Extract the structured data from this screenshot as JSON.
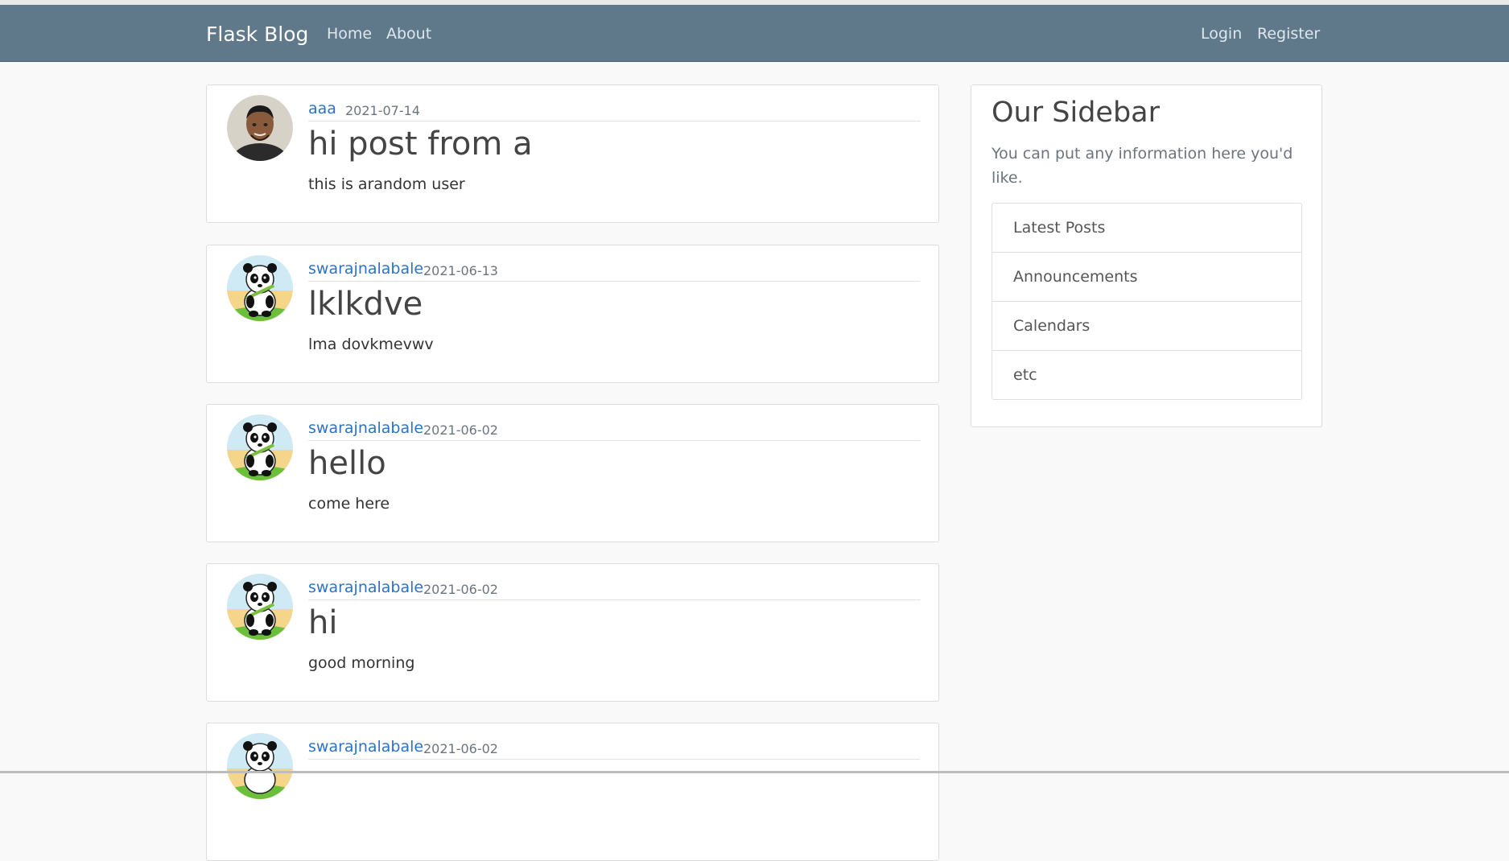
{
  "navbar": {
    "brand": "Flask Blog",
    "left_links": [
      "Home",
      "About"
    ],
    "right_links": [
      "Login",
      "Register"
    ]
  },
  "posts": [
    {
      "author": "aaa",
      "date": "2021-07-14",
      "title": "hi post from a",
      "content": "this is arandom user",
      "avatar": "person-photo"
    },
    {
      "author": "swarajnalabale",
      "date": "2021-06-13",
      "title": "lklkdve",
      "content": "lma dovkmevwv",
      "avatar": "panda-image"
    },
    {
      "author": "swarajnalabale",
      "date": "2021-06-02",
      "title": "hello",
      "content": "come here",
      "avatar": "panda-image"
    },
    {
      "author": "swarajnalabale",
      "date": "2021-06-02",
      "title": "hi",
      "content": "good morning",
      "avatar": "panda-image"
    },
    {
      "author": "swarajnalabale",
      "date": "2021-06-02",
      "title": "",
      "content": "",
      "avatar": "panda-image"
    }
  ],
  "sidebar": {
    "title": "Our Sidebar",
    "description": "You can put any information here you'd like.",
    "items": [
      "Latest Posts",
      "Announcements",
      "Calendars",
      "etc"
    ]
  },
  "colors": {
    "navbar": "#5f788a",
    "link": "#2a73c9",
    "background": "#f9f9f9"
  }
}
